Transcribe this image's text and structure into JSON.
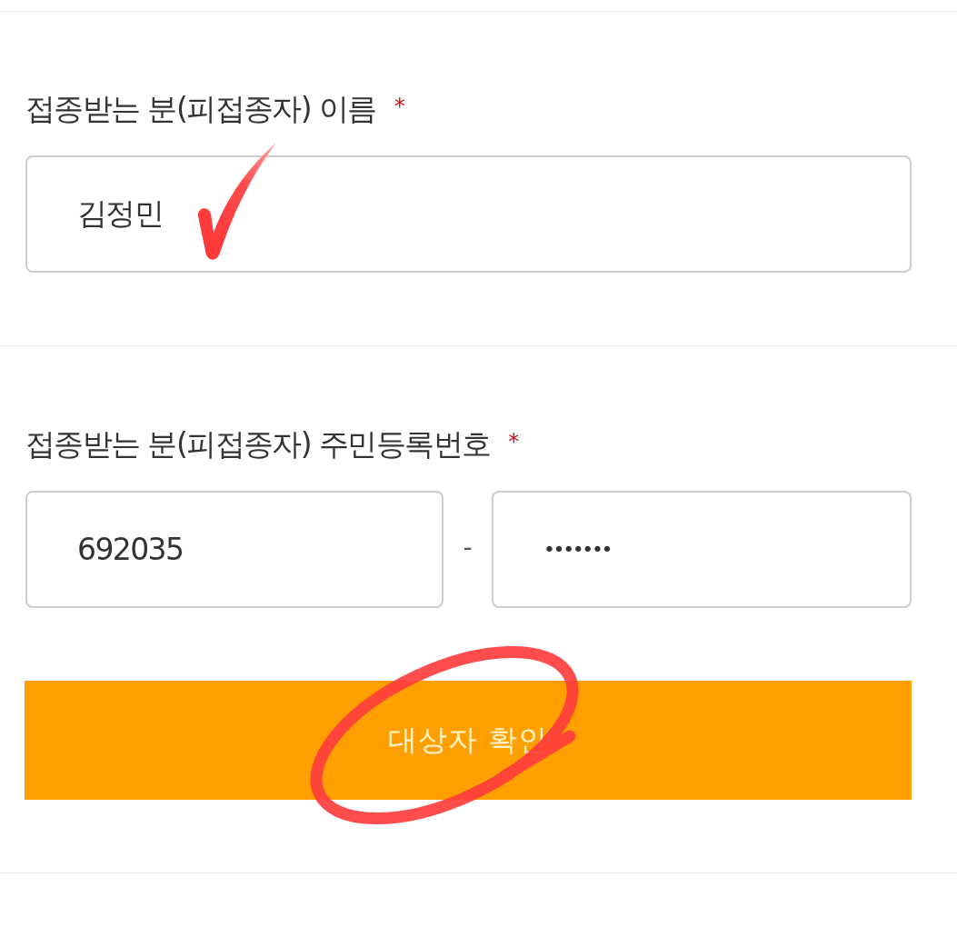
{
  "sections": [
    {
      "label": {
        "text": "접종받는 분(피접종자) 이름",
        "required_mark": "*"
      },
      "fields": [
        {
          "value": "김정민",
          "masked": false,
          "check_marked": true
        }
      ]
    },
    {
      "label": {
        "text": "접종받는 분(피접종자) 주민등록번호",
        "required_mark": "*"
      },
      "fields": [
        {
          "value": "692035",
          "masked": false,
          "check_marked": false
        },
        {
          "value": "•••••••",
          "masked": true,
          "check_marked": false
        }
      ],
      "separator": "-",
      "button": {
        "label": "대상자 확인",
        "circled": true
      }
    }
  ]
}
